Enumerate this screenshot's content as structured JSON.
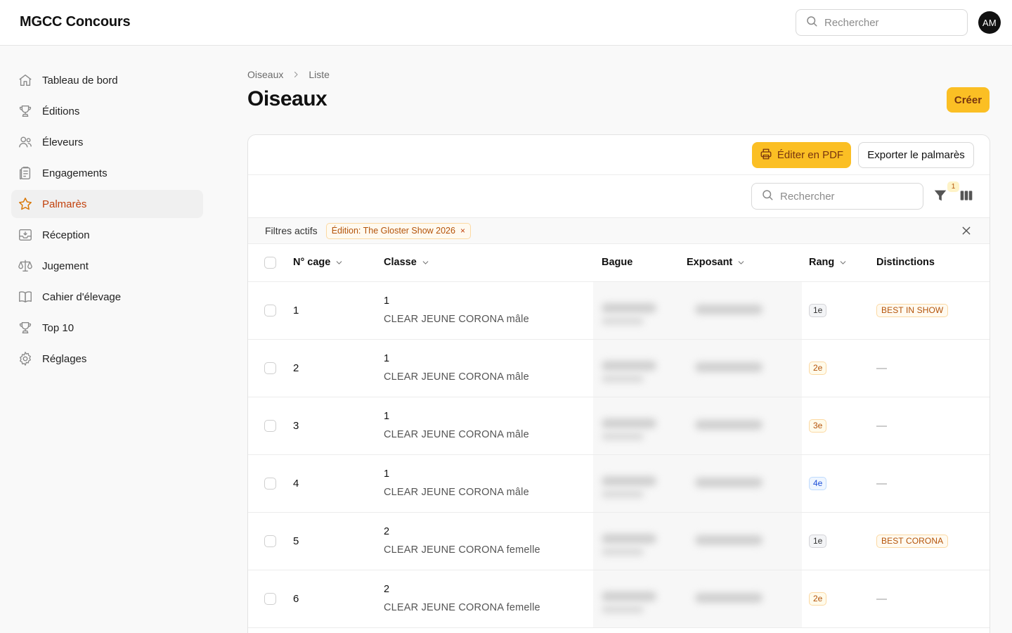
{
  "app": {
    "title": "MGCC Concours"
  },
  "header": {
    "search_placeholder": "Rechercher",
    "avatar_initials": "AM"
  },
  "sidebar": {
    "items": [
      {
        "label": "Tableau de bord",
        "icon": "home-icon",
        "active": false
      },
      {
        "label": "Éditions",
        "icon": "trophy-icon",
        "active": false
      },
      {
        "label": "Éleveurs",
        "icon": "users-icon",
        "active": false
      },
      {
        "label": "Engagements",
        "icon": "clipboard-icon",
        "active": false
      },
      {
        "label": "Palmarès",
        "icon": "star-icon",
        "active": true
      },
      {
        "label": "Réception",
        "icon": "inbox-icon",
        "active": false
      },
      {
        "label": "Jugement",
        "icon": "scale-icon",
        "active": false
      },
      {
        "label": "Cahier d'élevage",
        "icon": "book-icon",
        "active": false
      },
      {
        "label": "Top 10",
        "icon": "trophy-icon",
        "active": false
      },
      {
        "label": "Réglages",
        "icon": "gear-icon",
        "active": false
      }
    ]
  },
  "breadcrumb": {
    "parent": "Oiseaux",
    "current": "Liste"
  },
  "page": {
    "title": "Oiseaux",
    "create_label": "Créer"
  },
  "toolbar": {
    "pdf_label": "Éditer en PDF",
    "export_label": "Exporter le palmarès",
    "search_placeholder": "Rechercher",
    "filter_count": "1"
  },
  "filters": {
    "label": "Filtres actifs",
    "chips": [
      {
        "label": "Édition: The Gloster Show 2026"
      }
    ]
  },
  "table": {
    "columns": {
      "cage": "N° cage",
      "classe": "Classe",
      "bague": "Bague",
      "exposant": "Exposant",
      "rang": "Rang",
      "distinctions": "Distinctions"
    },
    "rows": [
      {
        "cage": "1",
        "class_num": "1",
        "class_name": "CLEAR JEUNE CORONA mâle",
        "rank": "1e",
        "rank_style": "1",
        "distinction": "BEST IN SHOW"
      },
      {
        "cage": "2",
        "class_num": "1",
        "class_name": "CLEAR JEUNE CORONA mâle",
        "rank": "2e",
        "rank_style": "2",
        "distinction": "—"
      },
      {
        "cage": "3",
        "class_num": "1",
        "class_name": "CLEAR JEUNE CORONA mâle",
        "rank": "3e",
        "rank_style": "3",
        "distinction": "—"
      },
      {
        "cage": "4",
        "class_num": "1",
        "class_name": "CLEAR JEUNE CORONA mâle",
        "rank": "4e",
        "rank_style": "4",
        "distinction": "—"
      },
      {
        "cage": "5",
        "class_num": "2",
        "class_name": "CLEAR JEUNE CORONA femelle",
        "rank": "1e",
        "rank_style": "1",
        "distinction": "BEST CORONA"
      },
      {
        "cage": "6",
        "class_num": "2",
        "class_name": "CLEAR JEUNE CORONA femelle",
        "rank": "2e",
        "rank_style": "2",
        "distinction": "—"
      }
    ]
  },
  "colors": {
    "accent": "#fbbf24",
    "accent_text": "#78350f",
    "active_nav": "#c2410c"
  }
}
